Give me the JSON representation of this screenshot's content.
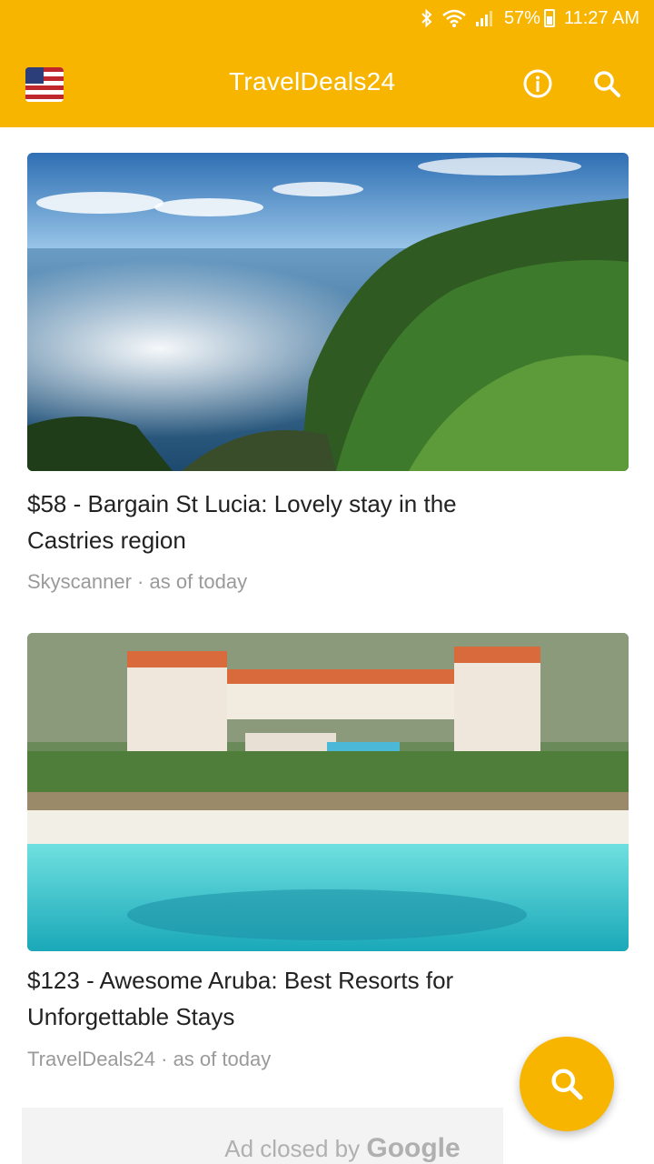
{
  "status_bar": {
    "battery": "57%",
    "time": "11:27 AM"
  },
  "app_bar": {
    "title": "TravelDeals24",
    "icons": [
      "us-flag-icon",
      "info-icon",
      "search-icon"
    ]
  },
  "articles": [
    {
      "headline": "$58 - Bargain St Lucia: Lovely stay in the Castries region",
      "source": "Skyscanner · as of today",
      "image": "coastline-photo"
    },
    {
      "headline": "$123 - Awesome Aruba: Best Resorts for Unforgettable Stays",
      "source": "TravelDeals24 · as of today",
      "image": "aruba-resort-photo"
    }
  ],
  "fab": {
    "icon": "search-icon"
  },
  "ad": {
    "text_prefix": "Ad closed by ",
    "brand": "Google"
  },
  "colors": {
    "accent": "#f7b500",
    "headline": "#222222",
    "meta": "#9a9a9a"
  }
}
